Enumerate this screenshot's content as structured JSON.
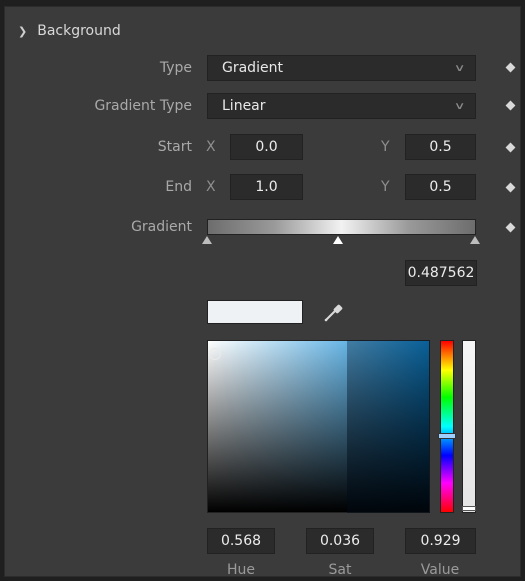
{
  "section": {
    "title": "Background",
    "expanded": true
  },
  "type": {
    "label": "Type",
    "value": "Gradient"
  },
  "gradient_type": {
    "label": "Gradient Type",
    "value": "Linear"
  },
  "start": {
    "label": "Start",
    "x_label": "X",
    "x": "0.0",
    "y_label": "Y",
    "y": "0.5"
  },
  "end": {
    "label": "End",
    "x_label": "X",
    "x": "1.0",
    "y_label": "Y",
    "y": "0.5"
  },
  "gradient": {
    "label": "Gradient",
    "stop_position": "0.487562"
  },
  "color_picker": {
    "hue": "0.568",
    "sat": "0.036",
    "value": "0.929",
    "hue_label": "Hue",
    "sat_label": "Sat",
    "value_label": "Value",
    "swatch_color": "#eef2f4",
    "accent_color": "#0d8ad6"
  },
  "icons": {
    "collapse": "chevron-down-icon",
    "keyframe": "keyframe-diamond-icon",
    "eyedropper": "eyedropper-icon"
  }
}
